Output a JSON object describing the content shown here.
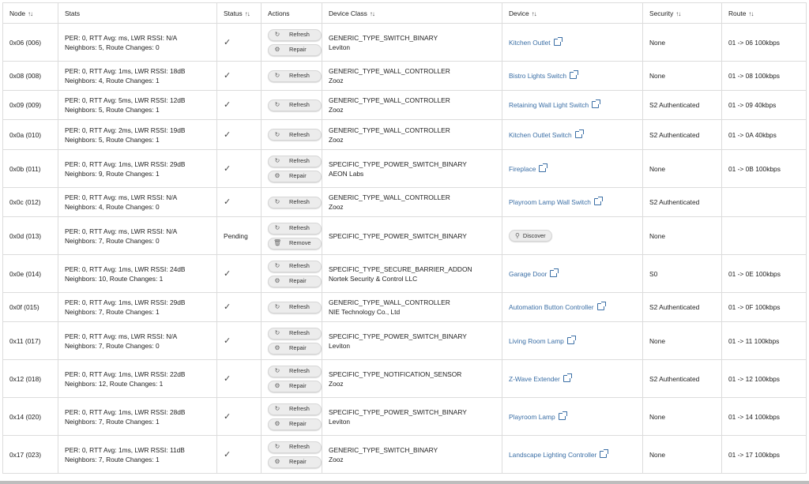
{
  "columns": {
    "node": "Node",
    "stats": "Stats",
    "status": "Status",
    "actions": "Actions",
    "device_class": "Device Class",
    "device": "Device",
    "security": "Security",
    "route": "Route"
  },
  "icons": {
    "sort": "sort-icon",
    "check": "check-icon",
    "refresh": "refresh-icon",
    "repair": "repair-icon",
    "remove": "trash-icon",
    "search": "search-icon",
    "external": "external-link-icon"
  },
  "accent_color": "#3a6ea5",
  "rows": [
    {
      "node": "0x06 (006)",
      "stats1": "PER: 0, RTT Avg: ms, LWR RSSI: N/A",
      "stats2": "Neighbors: 5, Route Changes: 0",
      "status": "✓",
      "actions": [
        "Refresh",
        "Repair"
      ],
      "class1": "GENERIC_TYPE_SWITCH_BINARY",
      "class2": "Leviton",
      "device": "Kitchen Outlet",
      "security": "None",
      "route": "01 -> 06 100kbps"
    },
    {
      "node": "0x08 (008)",
      "stats1": "PER: 0, RTT Avg: 1ms, LWR RSSI: 18dB",
      "stats2": "Neighbors: 4, Route Changes: 1",
      "status": "✓",
      "actions": [
        "Refresh"
      ],
      "class1": "GENERIC_TYPE_WALL_CONTROLLER",
      "class2": "Zooz",
      "device": "Bistro Lights Switch",
      "security": "None",
      "route": "01 -> 08 100kbps"
    },
    {
      "node": "0x09 (009)",
      "stats1": "PER: 0, RTT Avg: 5ms, LWR RSSI: 12dB",
      "stats2": "Neighbors: 5, Route Changes: 1",
      "status": "✓",
      "actions": [
        "Refresh"
      ],
      "class1": "GENERIC_TYPE_WALL_CONTROLLER",
      "class2": "Zooz",
      "device": "Retaining Wall Light Switch",
      "security": "S2 Authenticated",
      "route": "01 -> 09 40kbps"
    },
    {
      "node": "0x0a (010)",
      "stats1": "PER: 0, RTT Avg: 2ms, LWR RSSI: 19dB",
      "stats2": "Neighbors: 5, Route Changes: 1",
      "status": "✓",
      "actions": [
        "Refresh"
      ],
      "class1": "GENERIC_TYPE_WALL_CONTROLLER",
      "class2": "Zooz",
      "device": "Kitchen Outlet Switch",
      "security": "S2 Authenticated",
      "route": "01 -> 0A 40kbps"
    },
    {
      "node": "0x0b (011)",
      "stats1": "PER: 0, RTT Avg: 1ms, LWR RSSI: 29dB",
      "stats2": "Neighbors: 9, Route Changes: 1",
      "status": "✓",
      "actions": [
        "Refresh",
        "Repair"
      ],
      "class1": "SPECIFIC_TYPE_POWER_SWITCH_BINARY",
      "class2": "AEON Labs",
      "device": "Fireplace",
      "security": "None",
      "route": "01 -> 0B 100kbps"
    },
    {
      "node": "0x0c (012)",
      "stats1": "PER: 0, RTT Avg: ms, LWR RSSI: N/A",
      "stats2": "Neighbors: 4, Route Changes: 0",
      "status": "✓",
      "actions": [
        "Refresh"
      ],
      "class1": "GENERIC_TYPE_WALL_CONTROLLER",
      "class2": "Zooz",
      "device": "Playroom Lamp Wall Switch",
      "security": "S2 Authenticated",
      "route": ""
    },
    {
      "node": "0x0d (013)",
      "stats1": "PER: 0, RTT Avg: ms, LWR RSSI: N/A",
      "stats2": "Neighbors: 7, Route Changes: 0",
      "status": "Pending",
      "actions": [
        "Refresh",
        "Remove"
      ],
      "class1": "SPECIFIC_TYPE_POWER_SWITCH_BINARY",
      "class2": "",
      "device": "",
      "discover": "Discover",
      "security": "None",
      "route": ""
    },
    {
      "node": "0x0e (014)",
      "stats1": "PER: 0, RTT Avg: 1ms, LWR RSSI: 24dB",
      "stats2": "Neighbors: 10, Route Changes: 1",
      "status": "✓",
      "actions": [
        "Refresh",
        "Repair"
      ],
      "class1": "SPECIFIC_TYPE_SECURE_BARRIER_ADDON",
      "class2": "Nortek Security & Control LLC",
      "device": "Garage Door",
      "security": "S0",
      "route": "01 -> 0E 100kbps"
    },
    {
      "node": "0x0f (015)",
      "stats1": "PER: 0, RTT Avg: 1ms, LWR RSSI: 29dB",
      "stats2": "Neighbors: 7, Route Changes: 1",
      "status": "✓",
      "actions": [
        "Refresh"
      ],
      "class1": "GENERIC_TYPE_WALL_CONTROLLER",
      "class2": "NIE Technology Co., Ltd",
      "device": "Automation Button Controller",
      "security": "S2 Authenticated",
      "route": "01 -> 0F 100kbps"
    },
    {
      "node": "0x11 (017)",
      "stats1": "PER: 0, RTT Avg: ms, LWR RSSI: N/A",
      "stats2": "Neighbors: 7, Route Changes: 0",
      "status": "✓",
      "actions": [
        "Refresh",
        "Repair"
      ],
      "class1": "SPECIFIC_TYPE_POWER_SWITCH_BINARY",
      "class2": "Leviton",
      "device": "Living Room Lamp",
      "security": "None",
      "route": "01 -> 11 100kbps"
    },
    {
      "node": "0x12 (018)",
      "stats1": "PER: 0, RTT Avg: 1ms, LWR RSSI: 22dB",
      "stats2": "Neighbors: 12, Route Changes: 1",
      "status": "✓",
      "actions": [
        "Refresh",
        "Repair"
      ],
      "class1": "SPECIFIC_TYPE_NOTIFICATION_SENSOR",
      "class2": "Zooz",
      "device": "Z-Wave Extender",
      "security": "S2 Authenticated",
      "route": "01 -> 12 100kbps"
    },
    {
      "node": "0x14 (020)",
      "stats1": "PER: 0, RTT Avg: 1ms, LWR RSSI: 28dB",
      "stats2": "Neighbors: 7, Route Changes: 1",
      "status": "✓",
      "actions": [
        "Refresh",
        "Repair"
      ],
      "class1": "SPECIFIC_TYPE_POWER_SWITCH_BINARY",
      "class2": "Leviton",
      "device": "Playroom Lamp",
      "security": "None",
      "route": "01 -> 14 100kbps"
    },
    {
      "node": "0x17 (023)",
      "stats1": "PER: 0, RTT Avg: 1ms, LWR RSSI: 11dB",
      "stats2": "Neighbors: 7, Route Changes: 1",
      "status": "✓",
      "actions": [
        "Refresh",
        "Repair"
      ],
      "class1": "GENERIC_TYPE_SWITCH_BINARY",
      "class2": "Zooz",
      "device": "Landscape Lighting Controller",
      "security": "None",
      "route": "01 -> 17 100kbps"
    }
  ]
}
